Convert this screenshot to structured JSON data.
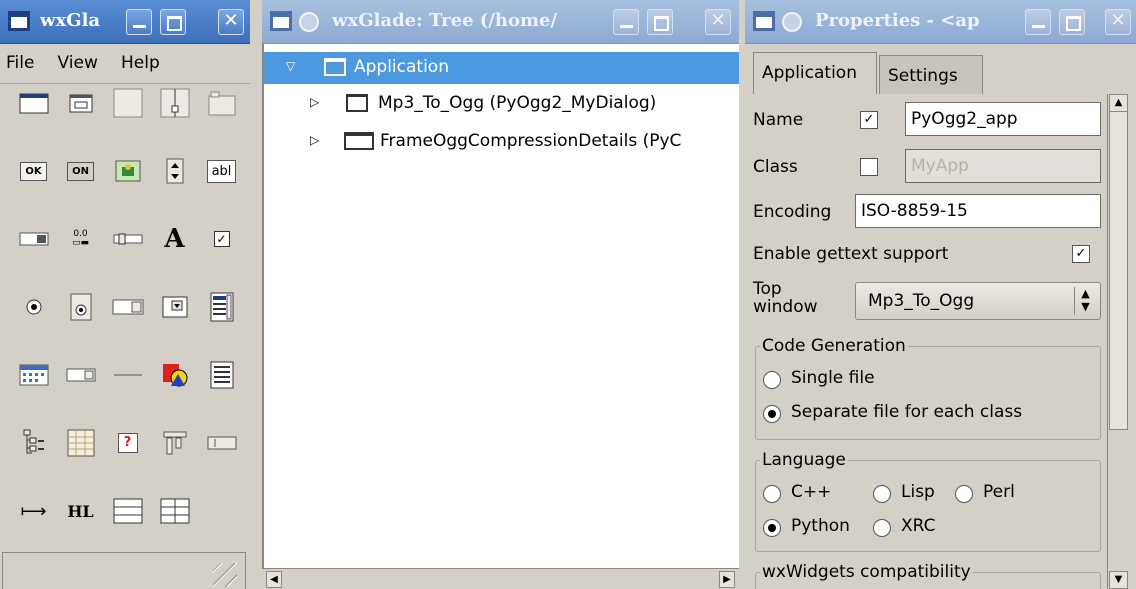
{
  "palette_window": {
    "title": "wxGla",
    "menu": [
      "File",
      "View",
      "Help"
    ],
    "tools": [
      [
        "frame-icon",
        "dialog-icon",
        "panel-icon",
        "splitter-icon",
        "notebook-icon"
      ],
      [
        "button-icon",
        "toggle-button-icon",
        "bitmap-button-icon",
        "spin-button-icon",
        "text-ctrl-icon"
      ],
      [
        "gauge-icon",
        "spin-ctrl-icon",
        "slider-icon",
        "static-text-icon",
        "checkbox-icon"
      ],
      [
        "radio-button-icon",
        "radio-box-icon",
        "choice-icon",
        "combo-box-icon",
        "list-box-icon"
      ],
      [
        "calendar-icon",
        "date-picker-icon",
        "static-line-icon",
        "static-bitmap-icon",
        "list-ctrl-icon"
      ],
      [
        "tree-ctrl-icon",
        "grid-icon",
        "custom-widget-icon",
        "toolbar-icon",
        "status-bar-icon"
      ],
      [
        "spacer-icon",
        "hyperlink-icon",
        "box-sizer-icon",
        "grid-sizer-icon"
      ]
    ],
    "labels": {
      "ok": "OK",
      "on": "ON",
      "abl": "abl",
      "a": "A",
      "hl": "HL",
      "num": "0.0",
      "q": "?"
    }
  },
  "tree_window": {
    "title": "wxGlade: Tree (/home/",
    "items": [
      {
        "label": "Application",
        "selected": true
      },
      {
        "label": "Mp3_To_Ogg (PyOgg2_MyDialog)",
        "selected": false
      },
      {
        "label": "FrameOggCompressionDetails (PyC",
        "selected": false
      }
    ]
  },
  "properties_window": {
    "title": "Properties - <ap",
    "tabs": [
      "Application",
      "Settings"
    ],
    "name_label": "Name",
    "name_checked": true,
    "name_value": "PyOgg2_app",
    "class_label": "Class",
    "class_checked": false,
    "class_value": "MyApp",
    "encoding_label": "Encoding",
    "encoding_value": "ISO-8859-15",
    "gettext_label": "Enable gettext support",
    "gettext_checked": true,
    "top_window_label_1": "Top",
    "top_window_label_2": "window",
    "top_window_value": "Mp3_To_Ogg",
    "code_generation": {
      "legend": "Code Generation",
      "options": [
        "Single file",
        "Separate file for each class"
      ],
      "selected": "Separate file for each class"
    },
    "language": {
      "legend": "Language",
      "options": [
        "C++",
        "Lisp",
        "Perl",
        "Python",
        "XRC"
      ],
      "selected": "Python"
    },
    "compat_legend": "wxWidgets compatibility"
  },
  "colors": {
    "titlebar_active": "#3d6fb8",
    "selection": "#4c99e0",
    "window_bg": "#d4d0c8"
  }
}
